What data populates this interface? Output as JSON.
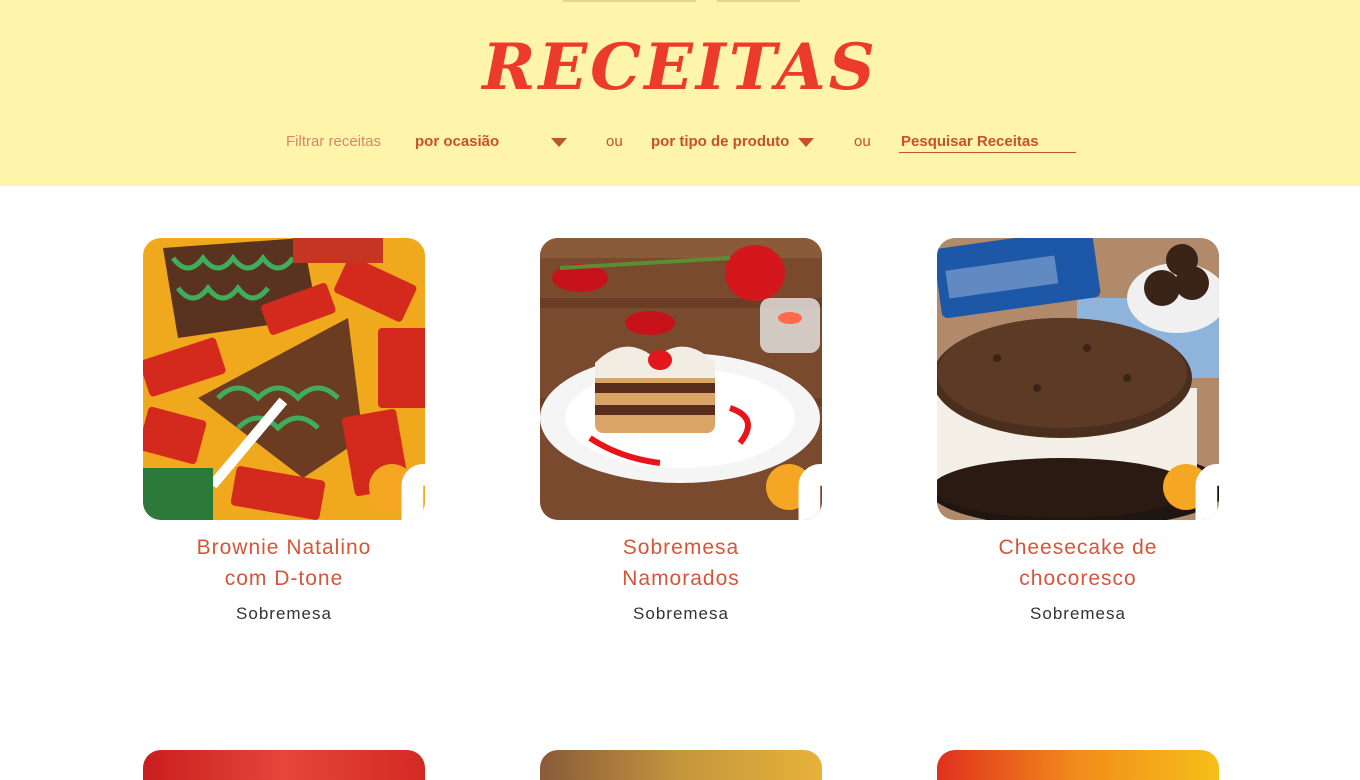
{
  "header": {
    "title": "RECEITAS",
    "filter_label": "Filtrar receitas",
    "occasion_dropdown": "por ocasião",
    "or_text": "ou",
    "type_dropdown": "por tipo de produto",
    "search_placeholder": "Pesquisar Receitas"
  },
  "recipes": [
    {
      "title": "Brownie Natalino com D-tone",
      "category": "Sobremesa"
    },
    {
      "title": "Sobremesa Namorados",
      "category": "Sobremesa"
    },
    {
      "title": "Cheesecake de chocoresco",
      "category": "Sobremesa"
    }
  ],
  "icons": {
    "recipe_button": "document-icon",
    "dropdown": "caret-down-icon"
  },
  "colors": {
    "header_bg": "#fff5aa",
    "title_red": "#ec3a2c",
    "accent_orange": "#f5a623",
    "text_rust": "#c6512a"
  }
}
